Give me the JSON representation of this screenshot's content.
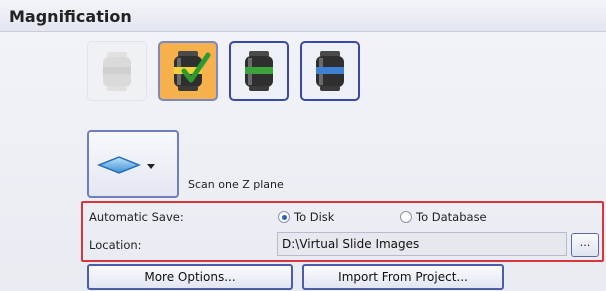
{
  "section": {
    "title": "Magnification"
  },
  "objectives": [
    {
      "icon": "objective-lens-disabled-icon",
      "band_color": "#d0d0d0",
      "state": "disabled"
    },
    {
      "icon": "objective-lens-yellow-icon",
      "band_color": "#f2d23a",
      "state": "selected",
      "check_color": "#2e9a2e"
    },
    {
      "icon": "objective-lens-green-icon",
      "band_color": "#3aa33a",
      "state": "available"
    },
    {
      "icon": "objective-lens-blue-icon",
      "band_color": "#3f7fd4",
      "state": "available"
    }
  ],
  "scan": {
    "icon": "scan-plane-icon",
    "dropdown_icon": "dropdown-arrow-icon",
    "label": "Scan one Z plane"
  },
  "save": {
    "automatic_save_label": "Automatic Save:",
    "option_disk": "To Disk",
    "option_database": "To Database",
    "selected": "To Disk",
    "location_label": "Location:",
    "location_value": "D:\\Virtual Slide Images",
    "browse_label": "..."
  },
  "buttons": {
    "more_options": "More Options...",
    "import_from_project": "Import From Project..."
  },
  "colors": {
    "highlight_border": "#d9353c",
    "selected_background": "#f6b14d",
    "button_border": "#4d5ea8"
  }
}
